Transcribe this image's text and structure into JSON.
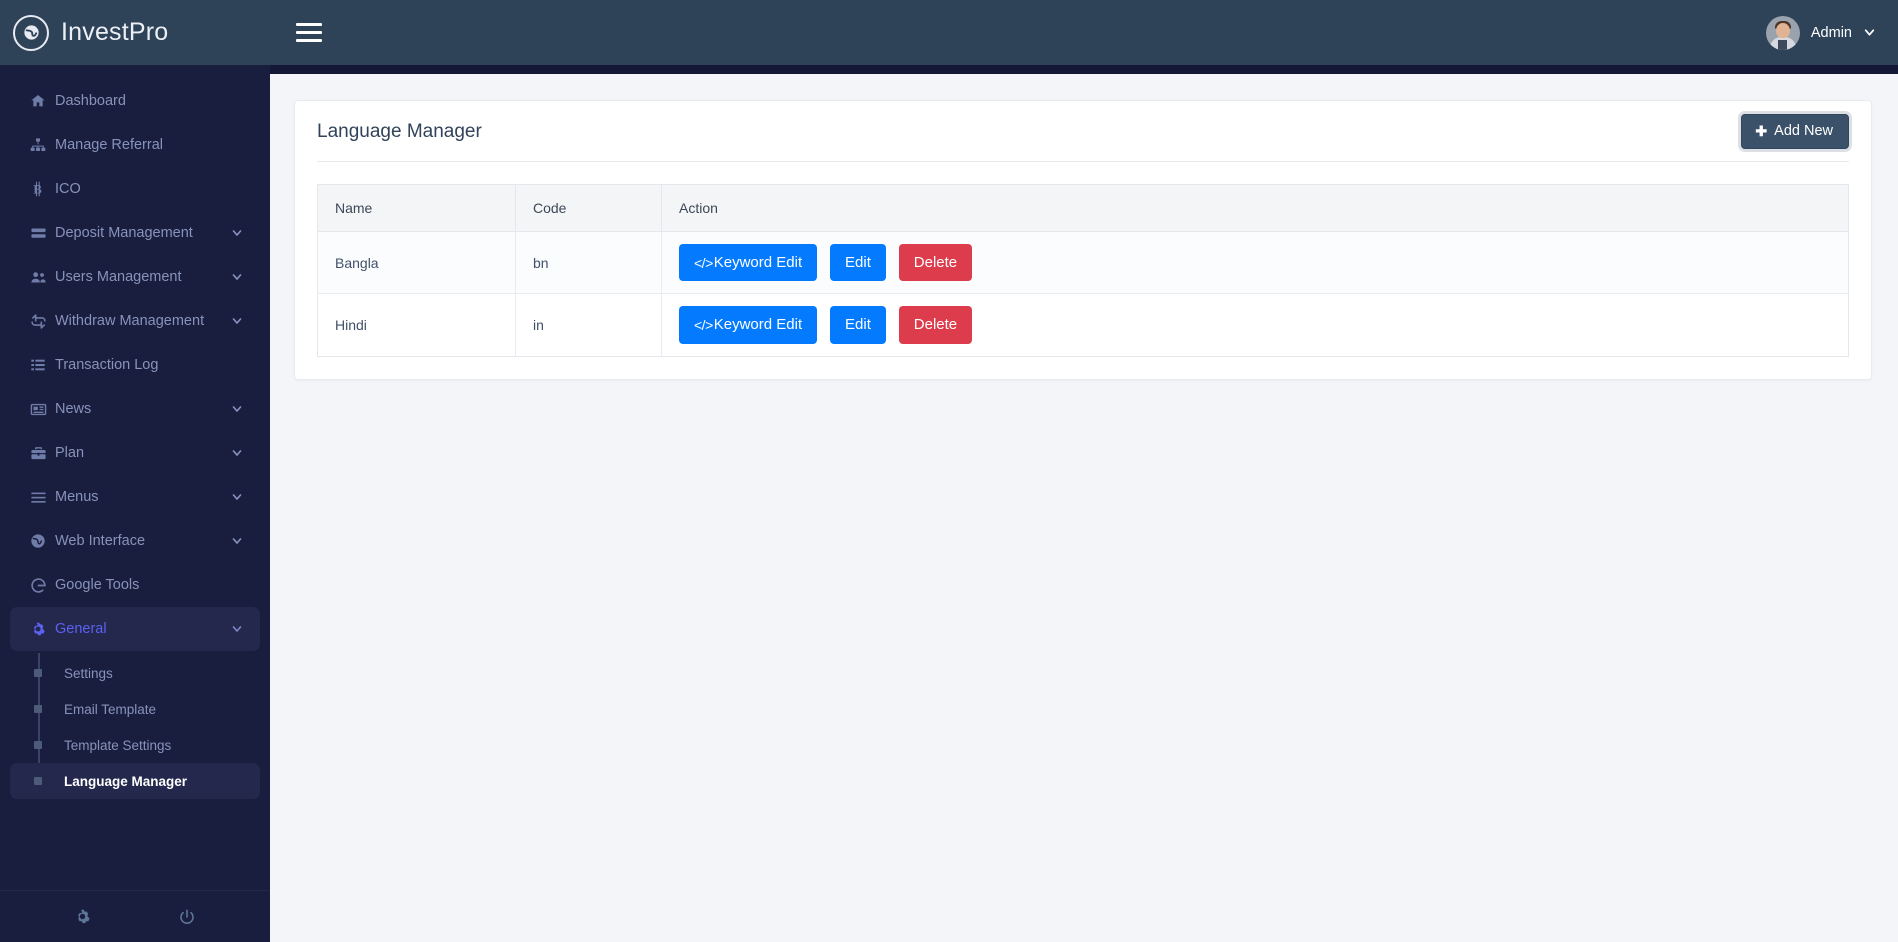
{
  "brand": {
    "name": "InvestPro",
    "logo_icon": "globe-icon"
  },
  "topbar": {
    "menu_toggle_icon": "hamburger-icon",
    "user_name": "Admin",
    "user_caret_icon": "chevron-down-icon",
    "avatar_icon": "user-avatar"
  },
  "sidebar": {
    "items": [
      {
        "label": "Dashboard",
        "icon": "home-icon",
        "expandable": false
      },
      {
        "label": "Manage Referral",
        "icon": "sitemap-icon",
        "expandable": false
      },
      {
        "label": "ICO",
        "icon": "bitcoin-icon",
        "expandable": false
      },
      {
        "label": "Deposit Management",
        "icon": "credit-card-icon",
        "expandable": true
      },
      {
        "label": "Users Management",
        "icon": "users-icon",
        "expandable": true
      },
      {
        "label": "Withdraw Management",
        "icon": "exchange-icon",
        "expandable": true
      },
      {
        "label": "Transaction Log",
        "icon": "list-icon",
        "expandable": false
      },
      {
        "label": "News",
        "icon": "newspaper-icon",
        "expandable": true
      },
      {
        "label": "Plan",
        "icon": "briefcase-icon",
        "expandable": true
      },
      {
        "label": "Menus",
        "icon": "bars-icon",
        "expandable": true
      },
      {
        "label": "Web Interface",
        "icon": "globe-icon",
        "expandable": true
      },
      {
        "label": "Google Tools",
        "icon": "google-icon",
        "expandable": false
      },
      {
        "label": "General",
        "icon": "gear-icon",
        "expandable": true,
        "active": true
      }
    ],
    "submenu": [
      {
        "label": "Settings",
        "active": false
      },
      {
        "label": "Email Template",
        "active": false
      },
      {
        "label": "Template Settings",
        "active": false
      },
      {
        "label": "Language Manager",
        "active": true
      }
    ],
    "footer_icons": [
      {
        "icon": "gear-icon",
        "name": "settings-icon"
      },
      {
        "icon": "power-icon",
        "name": "logout-icon"
      }
    ],
    "accent_color": "#5b61f0",
    "background_color": "#191d3e"
  },
  "page": {
    "title": "Language Manager",
    "add_new_label": "Add New",
    "add_new_icon": "plus-icon"
  },
  "table": {
    "columns": [
      "Name",
      "Code",
      "Action"
    ],
    "rows": [
      {
        "name": "Bangla",
        "code": "bn",
        "actions": [
          {
            "label": "Keyword Edit",
            "icon": "code-icon",
            "style": "blue"
          },
          {
            "label": "Edit",
            "style": "blue"
          },
          {
            "label": "Delete",
            "style": "red"
          }
        ]
      },
      {
        "name": "Hindi",
        "code": "in",
        "actions": [
          {
            "label": "Keyword Edit",
            "icon": "code-icon",
            "style": "blue"
          },
          {
            "label": "Edit",
            "style": "blue"
          },
          {
            "label": "Delete",
            "style": "red"
          }
        ]
      }
    ]
  },
  "colors": {
    "primary_blue": "#047bff",
    "danger_red": "#dc3c4b",
    "topbar": "#2e4258",
    "page_bg": "#f4f5f9"
  }
}
